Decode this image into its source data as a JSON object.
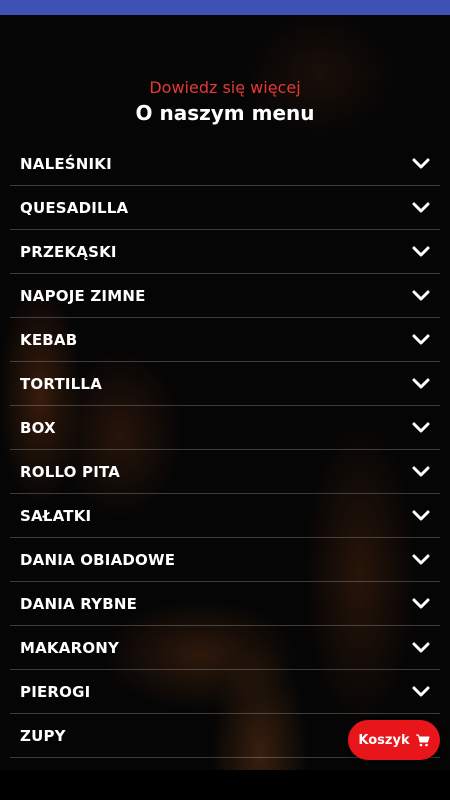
{
  "header": {
    "subtitle": "Dowiedz się więcej",
    "title": "O naszym menu"
  },
  "menu": {
    "items": [
      {
        "label": "NALEŚNIKI"
      },
      {
        "label": "QUESADILLA"
      },
      {
        "label": "PRZEKĄSKI"
      },
      {
        "label": "NAPOJE ZIMNE"
      },
      {
        "label": "KEBAB"
      },
      {
        "label": "TORTILLA"
      },
      {
        "label": "BOX"
      },
      {
        "label": "ROLLO PITA"
      },
      {
        "label": "SAŁATKI"
      },
      {
        "label": "DANIA OBIADOWE"
      },
      {
        "label": "DANIA RYBNE"
      },
      {
        "label": "MAKARONY"
      },
      {
        "label": "PIEROGI"
      },
      {
        "label": "ZUPY"
      }
    ],
    "expand_icon": "chevron-down-icon"
  },
  "cart": {
    "label": "Koszyk",
    "icon": "shopping-cart-icon",
    "color": "#e8151b"
  },
  "colors": {
    "accent": "#e53935",
    "status_bar": "#3f51b5",
    "background": "#050505"
  }
}
